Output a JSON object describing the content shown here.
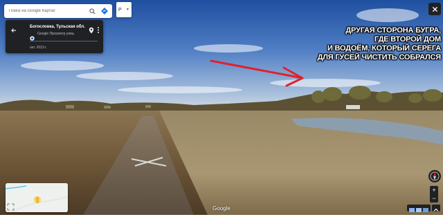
{
  "search": {
    "placeholder": "Поиск на Google Картах"
  },
  "layer_toggle": {
    "label": "Р"
  },
  "location_card": {
    "title": "Богословка, Тульская обл.",
    "source": "Google Просмотр улиц",
    "date": "окт. 2013 г."
  },
  "annotation": {
    "lines": [
      "ДРУГАЯ СТОРОНА БУГРА,",
      "ГДЕ ВТОРОЙ ДОМ",
      "И ВОДОЁМ, КОТОРЫЙ СЕРЕГА",
      "ДЛЯ ГУСЕЙ ЧИСТИТЬ СОБРАЛСЯ"
    ],
    "arrow_color": "#e2202a"
  },
  "controls": {
    "zoom_in": "+",
    "zoom_out": "−"
  },
  "brand": {
    "google": "Google"
  },
  "colors": {
    "card_bg": "#202124",
    "accent_blue": "#1a73e8"
  },
  "icons": [
    "search-icon",
    "directions-icon",
    "back-arrow-icon",
    "street-view-icon",
    "pin-icon",
    "more-icon",
    "close-icon",
    "compass-icon",
    "pegman-icon",
    "fullscreen-icon",
    "up-chevron-icon"
  ]
}
